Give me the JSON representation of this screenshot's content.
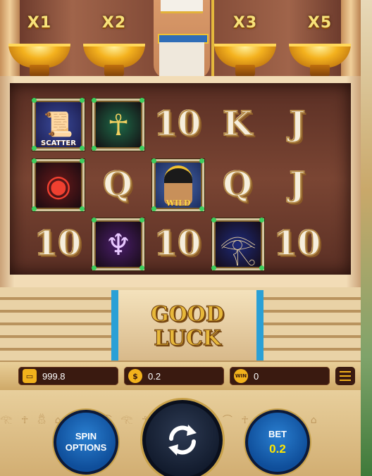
{
  "multipliers": [
    "X1",
    "X2",
    "X3",
    "X5"
  ],
  "reels": [
    [
      "scatter",
      "ankh-green",
      "10",
      "K",
      "J"
    ],
    [
      "ring-red",
      "Q",
      "cleopatra",
      "Q",
      "J"
    ],
    [
      "10",
      "scarab-purple",
      "10",
      "eye-blue",
      "10"
    ]
  ],
  "symbols": {
    "scatter_label": "SCATTER",
    "wild_label": "WILD"
  },
  "banner": {
    "line1": "GOOD",
    "line2": "LUCK"
  },
  "balance": {
    "value": "999.8"
  },
  "bet_field": {
    "icon": "$",
    "value": "0.2"
  },
  "win_field": {
    "icon": "WIN",
    "value": "0"
  },
  "buttons": {
    "spin_options_line1": "SPIN",
    "spin_options_line2": "OPTIONS",
    "bet_label": "BET",
    "bet_value": "0.2"
  },
  "colors": {
    "gold": "#f7e27a",
    "button_blue": "#1a63b5",
    "panel_dark": "#3a1a10",
    "bet_value_color": "#ffe600"
  }
}
